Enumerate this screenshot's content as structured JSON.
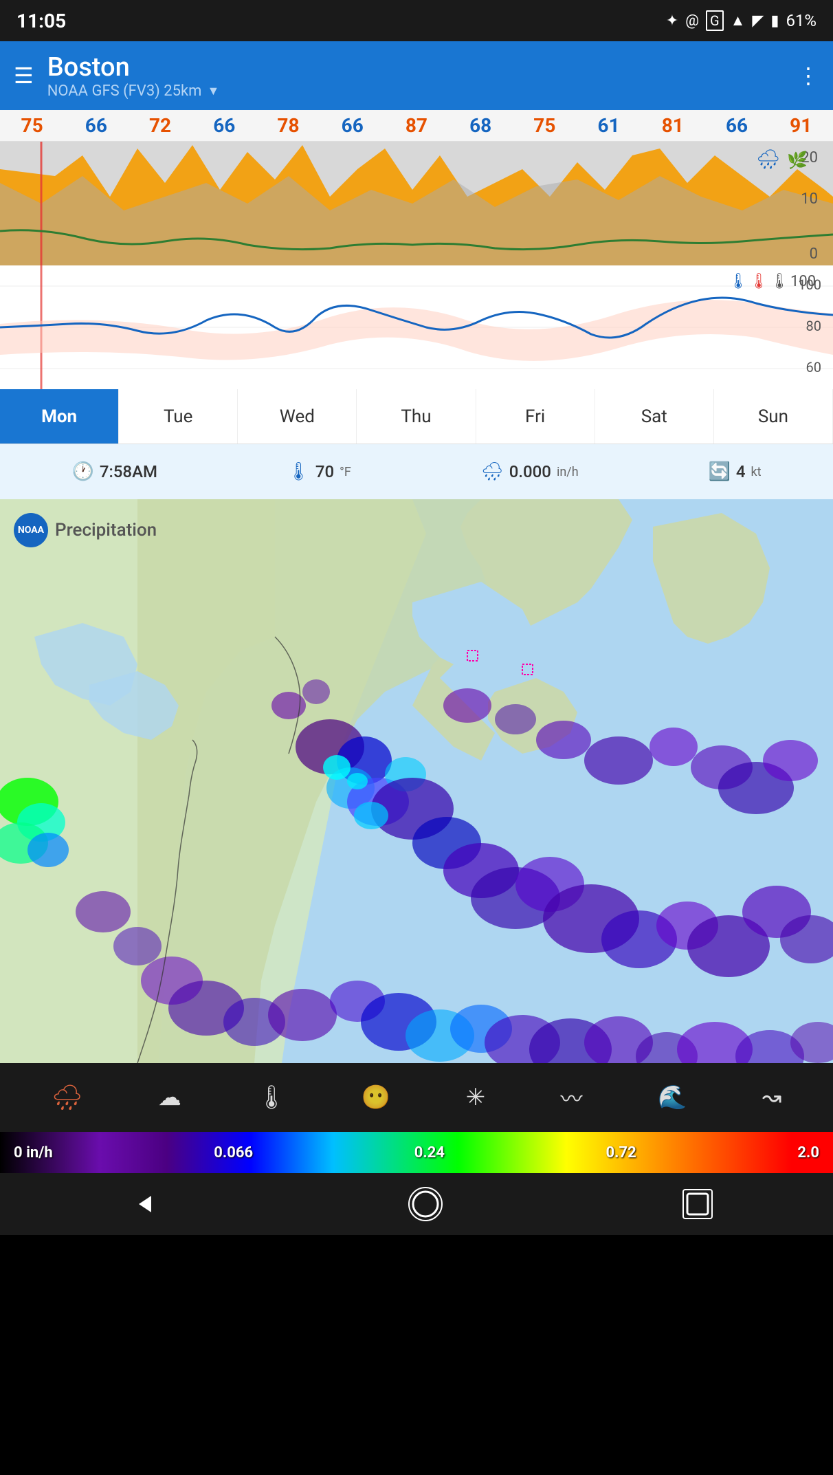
{
  "status_bar": {
    "time": "11:05",
    "battery": "61%",
    "icons": [
      "notification",
      "at",
      "ge"
    ]
  },
  "header": {
    "city": "Boston",
    "model": "NOAA GFS (FV3) 25km",
    "menu_icon": "☰",
    "more_icon": "⋮"
  },
  "temperatures": [
    {
      "value": "75",
      "type": "orange"
    },
    {
      "value": "66",
      "type": "blue"
    },
    {
      "value": "72",
      "type": "orange"
    },
    {
      "value": "66",
      "type": "blue"
    },
    {
      "value": "78",
      "type": "orange"
    },
    {
      "value": "66",
      "type": "blue"
    },
    {
      "value": "87",
      "type": "orange"
    },
    {
      "value": "68",
      "type": "blue"
    },
    {
      "value": "75",
      "type": "orange"
    },
    {
      "value": "61",
      "type": "blue"
    },
    {
      "value": "81",
      "type": "orange"
    },
    {
      "value": "66",
      "type": "blue"
    },
    {
      "value": "91",
      "type": "orange"
    }
  ],
  "day_tabs": [
    {
      "label": "Mon",
      "active": true
    },
    {
      "label": "Tue",
      "active": false
    },
    {
      "label": "Wed",
      "active": false
    },
    {
      "label": "Thu",
      "active": false
    },
    {
      "label": "Fri",
      "active": false
    },
    {
      "label": "Sat",
      "active": false
    },
    {
      "label": "Sun",
      "active": false
    }
  ],
  "info_row": {
    "time": {
      "icon": "🕐",
      "value": "7:58AM"
    },
    "temp": {
      "icon": "🌡",
      "value": "70",
      "unit": "°F"
    },
    "precip": {
      "icon": "🌧",
      "value": "0.000",
      "unit": "in/h"
    },
    "wind": {
      "icon": "🔄",
      "value": "4",
      "unit": "kt"
    }
  },
  "map": {
    "title": "Precipitation",
    "layer_label": "Precipitation"
  },
  "color_scale": {
    "labels": [
      "0 in/h",
      "0.066",
      "0.24",
      "0.72",
      "2.0"
    ]
  },
  "bottom_icons": [
    {
      "name": "precipitation-icon",
      "symbol": "🌧",
      "active": true
    },
    {
      "name": "cloud-icon",
      "symbol": "☁",
      "active": false
    },
    {
      "name": "thermometer-icon",
      "symbol": "🌡",
      "active": false
    },
    {
      "name": "wind-face-icon",
      "symbol": "😶",
      "active": false
    },
    {
      "name": "wind-icon",
      "symbol": "✳",
      "active": false
    },
    {
      "name": "wave-icon",
      "symbol": "〰",
      "active": false
    },
    {
      "name": "current-icon",
      "symbol": "🌊",
      "active": false
    },
    {
      "name": "flow-icon",
      "symbol": "↝",
      "active": false
    }
  ],
  "temp_chart": {
    "y_labels": [
      "100",
      "80",
      "60"
    ],
    "icons": [
      "🌡",
      "🌡",
      "🌡"
    ]
  },
  "precip_chart": {
    "y_labels": [
      "20",
      "10",
      "0"
    ]
  }
}
